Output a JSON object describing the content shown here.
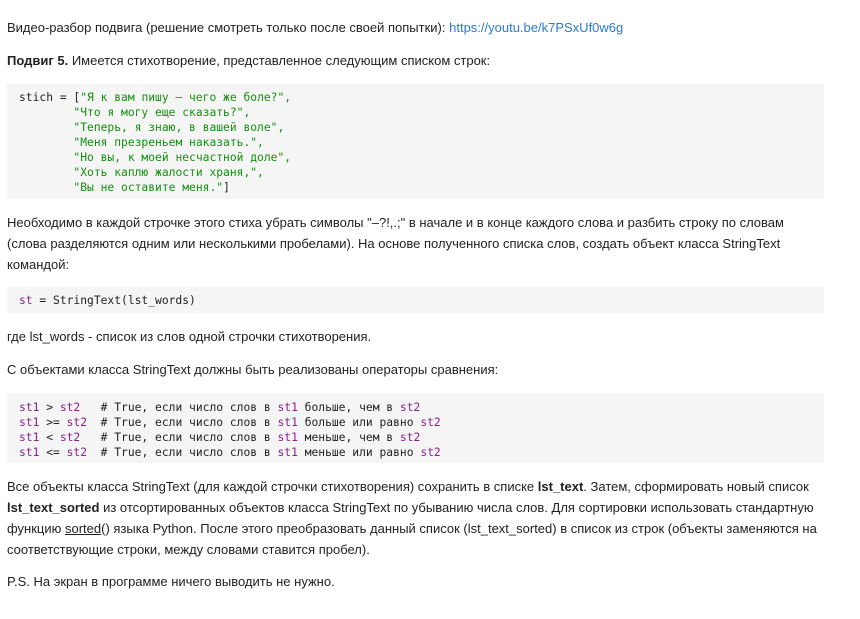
{
  "intro": {
    "text": "Видео-разбор подвига (решение смотреть только после своей попытки): ",
    "link": "https://youtu.be/k7PSxUf0w6g"
  },
  "task": {
    "bold": "Подвиг 5.",
    "text": " Имеется стихотворение, представленное следующим списком строк:"
  },
  "code1": {
    "var": "stich",
    "assign": " = [",
    "lines": [
      "\"Я к вам пишу – чего же боле?\",",
      "\"Что я могу еще сказать?\",",
      "\"Теперь, я знаю, в вашей воле\",",
      "\"Меня презреньем наказать.\",",
      "\"Но вы, к моей несчастной доле\",",
      "\"Хоть каплю жалости храня,\",",
      "\"Вы не оставите меня.\""
    ],
    "close": "]"
  },
  "para1": "Необходимо в каждой строчке этого стиха убрать символы \"–?!,.;\" в начале и в конце каждого слова и разбить строку по словам (слова разделяются одним или несколькими пробелами). На основе полученного списка слов, создать объект класса StringText командой:",
  "code2": {
    "var": "st",
    "rest": " = StringText(lst_words)"
  },
  "para2": "где lst_words - список из слов одной строчки стихотворения.",
  "para3": "С объектами класса StringText должны быть реализованы операторы сравнения:",
  "code3": {
    "rows": [
      {
        "a": "st1",
        "op": " > ",
        "b": "st2",
        "pad": "   ",
        "c1": "# True, если число слов в ",
        "x": "st1",
        "c2": " больше, чем в ",
        "y": "st2"
      },
      {
        "a": "st1",
        "op": " >= ",
        "b": "st2",
        "pad": "  ",
        "c1": "# True, если число слов в ",
        "x": "st1",
        "c2": " больше или равно ",
        "y": "st2"
      },
      {
        "a": "st1",
        "op": " < ",
        "b": "st2",
        "pad": "   ",
        "c1": "# True, если число слов в ",
        "x": "st1",
        "c2": " меньше, чем в ",
        "y": "st2"
      },
      {
        "a": "st1",
        "op": " <= ",
        "b": "st2",
        "pad": "  ",
        "c1": "# True, если число слов в ",
        "x": "st1",
        "c2": " меньше или равно ",
        "y": "st2"
      }
    ]
  },
  "para4": {
    "t1": "Все объекты класса StringText (для каждой строчки стихотворения) сохранить в списке ",
    "b1": "lst_text",
    "t2": ". Затем, сформировать новый список ",
    "b2": "lst_text_sorted",
    "t3": " из отсортированных объектов класса StringText по убыванию числа слов. Для сортировки использовать стандартную функцию ",
    "u1": "sorted",
    "t4": "() языка Python. После этого преобразовать данный список (lst_text_sorted) в список из строк (объекты заменяются на соответствующие строки, между словами ставится пробел)."
  },
  "para5": "P.S. На экран в программе ничего выводить не нужно."
}
